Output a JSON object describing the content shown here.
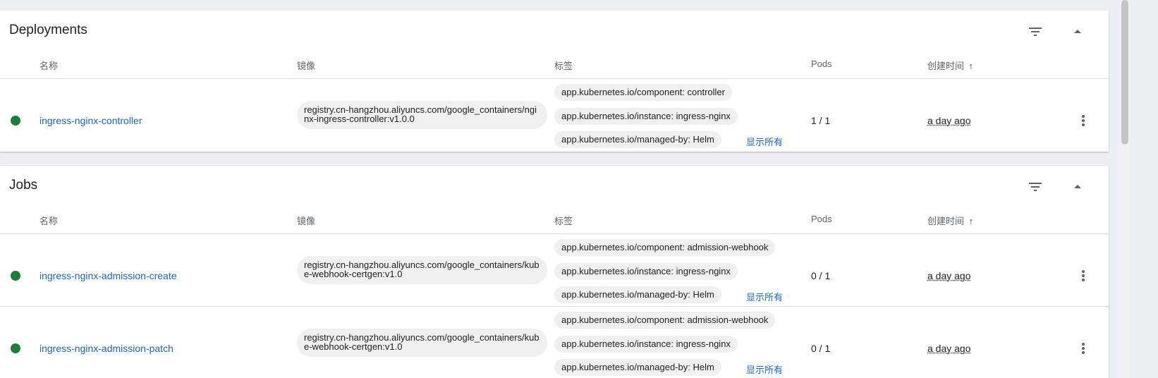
{
  "columns": {
    "name": "名称",
    "image": "镜像",
    "labels": "标签",
    "pods": "Pods",
    "created": "创建时间"
  },
  "sort_arrow": "↑",
  "icons": {
    "filter": "filter-icon",
    "collapse": "chevron-up-icon",
    "more": "more-vert-icon",
    "status": "status-running-icon"
  },
  "colors": {
    "status_ok": "#188038",
    "link": "#1a66c9",
    "chip_bg": "#f0f0f0"
  },
  "deployments": {
    "title": "Deployments",
    "rows": [
      {
        "name": "ingress-nginx-controller",
        "image": "registry.cn-hangzhou.aliyuncs.com/google_containers/nginx-ingress-controller:v1.0.0",
        "labels": [
          "app.kubernetes.io/component: controller",
          "app.kubernetes.io/instance: ingress-nginx",
          "app.kubernetes.io/managed-by: Helm"
        ],
        "show_all": "显示所有",
        "pods": "1 / 1",
        "created": "a day ago"
      }
    ]
  },
  "jobs": {
    "title": "Jobs",
    "rows": [
      {
        "name": "ingress-nginx-admission-create",
        "image": "registry.cn-hangzhou.aliyuncs.com/google_containers/kube-webhook-certgen:v1.0",
        "labels": [
          "app.kubernetes.io/component: admission-webhook",
          "app.kubernetes.io/instance: ingress-nginx",
          "app.kubernetes.io/managed-by: Helm"
        ],
        "show_all": "显示所有",
        "pods": "0 / 1",
        "created": "a day ago"
      },
      {
        "name": "ingress-nginx-admission-patch",
        "image": "registry.cn-hangzhou.aliyuncs.com/google_containers/kube-webhook-certgen:v1.0",
        "labels": [
          "app.kubernetes.io/component: admission-webhook",
          "app.kubernetes.io/instance: ingress-nginx",
          "app.kubernetes.io/managed-by: Helm"
        ],
        "show_all": "显示所有",
        "pods": "0 / 1",
        "created": "a day ago"
      }
    ]
  }
}
